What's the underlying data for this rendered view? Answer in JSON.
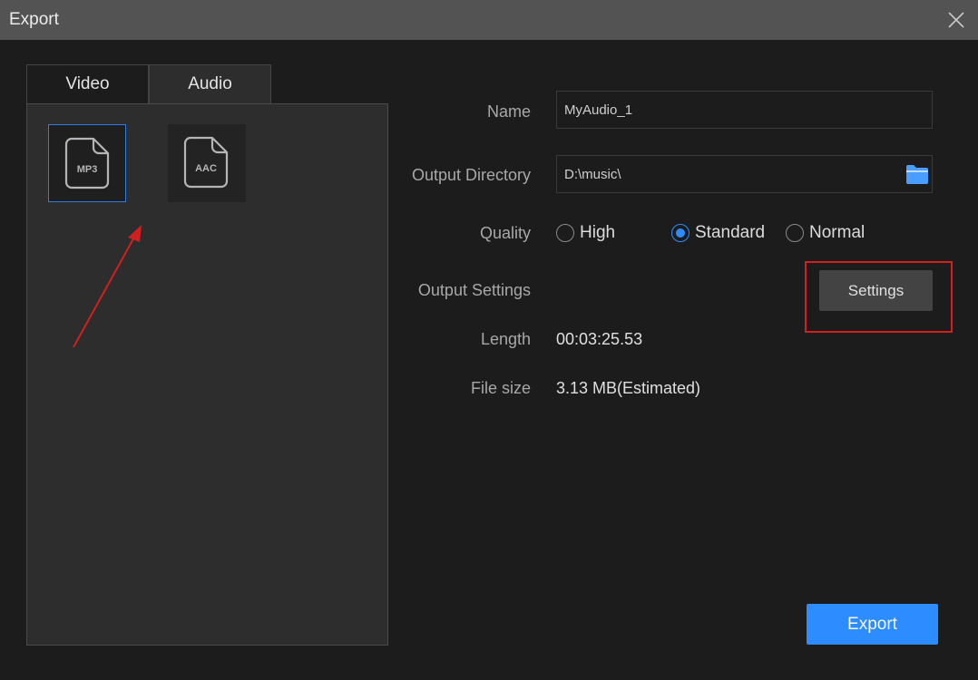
{
  "window": {
    "title": "Export"
  },
  "tabs": [
    {
      "label": "Video",
      "active": false
    },
    {
      "label": "Audio",
      "active": true
    }
  ],
  "formats": [
    {
      "label": "MP3",
      "selected": true
    },
    {
      "label": "AAC",
      "selected": false
    }
  ],
  "form": {
    "name_label": "Name",
    "name_value": "MyAudio_1",
    "directory_label": "Output Directory",
    "directory_value": "D:\\music\\",
    "quality_label": "Quality",
    "quality_options": [
      {
        "label": "High",
        "selected": false
      },
      {
        "label": "Standard",
        "selected": true
      },
      {
        "label": "Normal",
        "selected": false
      }
    ],
    "output_settings_label": "Output Settings",
    "settings_button": "Settings",
    "length_label": "Length",
    "length_value": "00:03:25.53",
    "filesize_label": "File size",
    "filesize_value": "3.13 MB(Estimated)"
  },
  "footer": {
    "export_button": "Export"
  },
  "colors": {
    "accent": "#2d8cff",
    "annotation": "#d21f1f"
  }
}
